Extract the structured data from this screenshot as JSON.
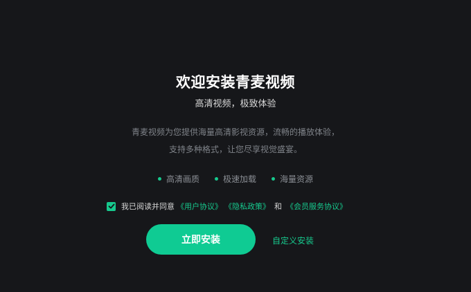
{
  "installer": {
    "title": "欢迎安装青麦视频",
    "subtitle": "高清视频，极致体验",
    "description_line1": "青麦视频为您提供海量高清影视资源，流畅的播放体验，",
    "description_line2": "支持多种格式，让您尽享视觉盛宴。",
    "features": [
      {
        "label": "高清画质"
      },
      {
        "label": "极速加载"
      },
      {
        "label": "海量资源"
      }
    ],
    "agreement": {
      "checked": true,
      "prefix": "我已阅读并同意",
      "user_agreement": "《用户协议》",
      "privacy_policy": "《隐私政策》",
      "and": "和",
      "membership_agreement": "《会员服务协议》"
    },
    "install_button": "立即安装",
    "custom_install_link": "自定义安装"
  },
  "colors": {
    "background": "#16171a",
    "accent": "#0fcb93",
    "link": "#16c98d",
    "muted_text": "#7f8389"
  }
}
